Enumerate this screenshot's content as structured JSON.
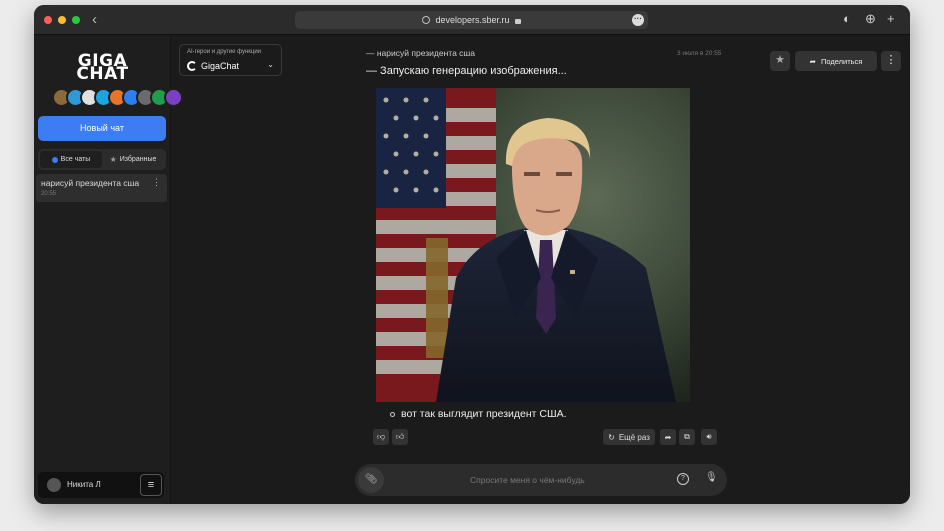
{
  "browser": {
    "url": "developers.sber.ru"
  },
  "sidebar": {
    "logo_line1": "GIGA",
    "logo_line2": "CHAT",
    "new_chat_label": "Новый чат",
    "filters": [
      {
        "label": "Все чаты",
        "active": true
      },
      {
        "label": "Избранные",
        "active": false
      }
    ],
    "chats": [
      {
        "title": "нарисуй президента сша",
        "time": "20:55"
      }
    ],
    "user_name": "Никита Л"
  },
  "model": {
    "caption": "AI-герои и другие функции",
    "name": "GigaChat"
  },
  "header": {
    "share_label": "Поделиться"
  },
  "conversation": {
    "user_message": "— нарисуй президента сша",
    "date": "3 июля в 20:55",
    "bot_message": "— Запускаю генерацию изображения...",
    "bot_caption": "вот так выглядит президент США.",
    "actions": {
      "retry_label": "Ещё раз"
    }
  },
  "input": {
    "placeholder": "Спросите меня о чём-нибудь"
  },
  "colors": {
    "accent": "#3d7cf2",
    "background": "#1b1b1b",
    "sidebar": "#1e1e1e"
  }
}
